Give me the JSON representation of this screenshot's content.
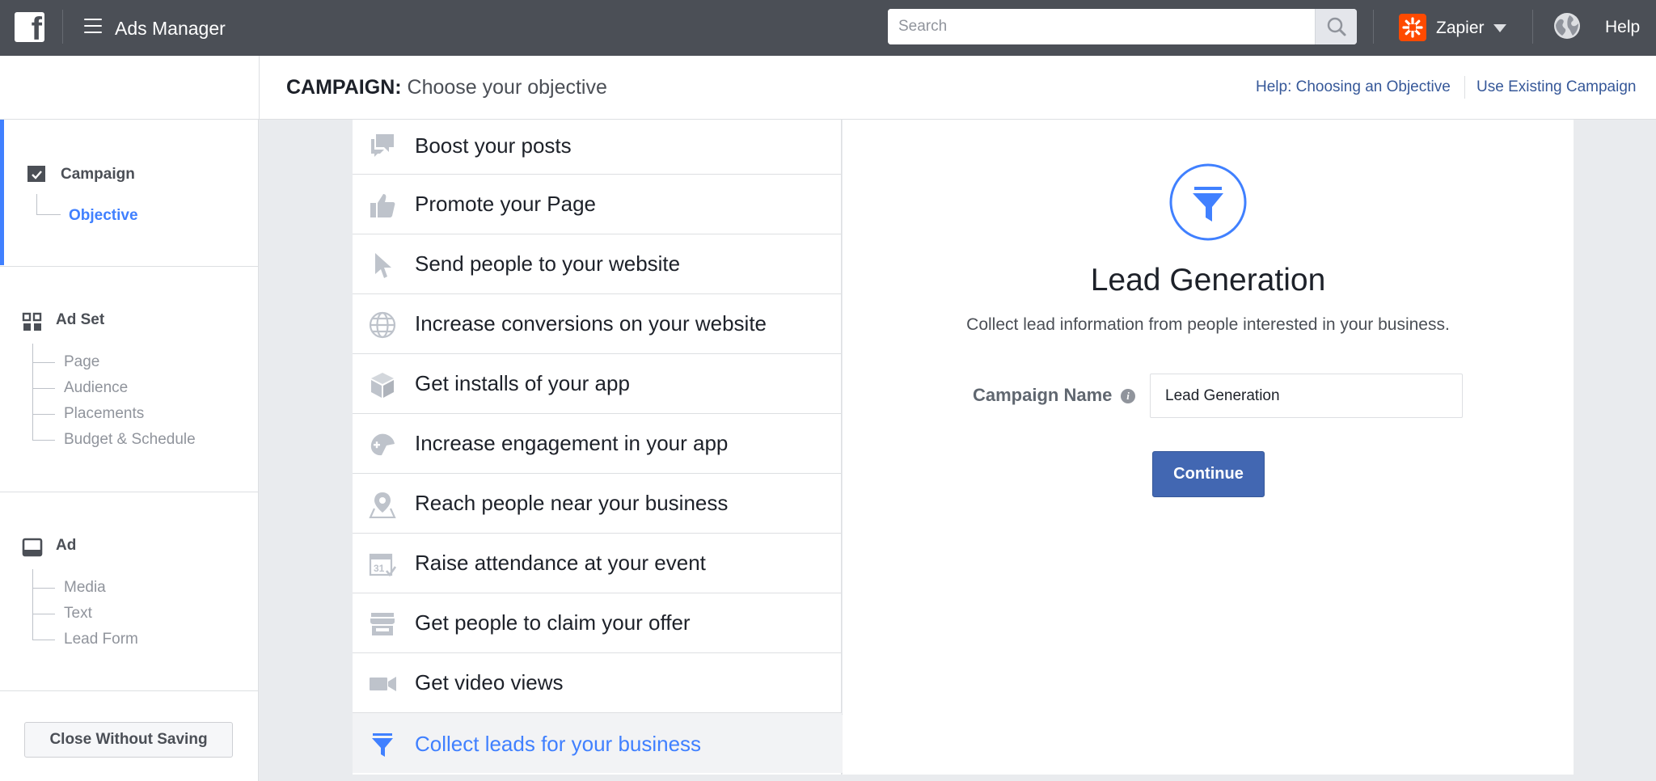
{
  "topbar": {
    "logo_letter": "f",
    "app_title": "Ads Manager",
    "search_placeholder": "Search",
    "account_name": "Zapier",
    "help_label": "Help"
  },
  "header": {
    "title_prefix": "CAMPAIGN:",
    "title_text": "Choose your objective",
    "links": [
      "Help: Choosing an Objective",
      "Use Existing Campaign"
    ]
  },
  "sidebar": {
    "campaign": {
      "title": "Campaign",
      "items": [
        "Objective"
      ],
      "active_item": "Objective"
    },
    "ad_set": {
      "title": "Ad Set",
      "items": [
        "Page",
        "Audience",
        "Placements",
        "Budget & Schedule"
      ]
    },
    "ad": {
      "title": "Ad",
      "items": [
        "Media",
        "Text",
        "Lead Form"
      ]
    },
    "close_button": "Close Without Saving"
  },
  "objectives": [
    {
      "label": "Boost your posts",
      "icon": "speech-bubbles-icon"
    },
    {
      "label": "Promote your Page",
      "icon": "thumbs-up-icon"
    },
    {
      "label": "Send people to your website",
      "icon": "cursor-icon"
    },
    {
      "label": "Increase conversions on your website",
      "icon": "globe-icon"
    },
    {
      "label": "Get installs of your app",
      "icon": "box-icon"
    },
    {
      "label": "Increase engagement in your app",
      "icon": "gamepad-icon"
    },
    {
      "label": "Reach people near your business",
      "icon": "map-pin-icon"
    },
    {
      "label": "Raise attendance at your event",
      "icon": "calendar-icon"
    },
    {
      "label": "Get people to claim your offer",
      "icon": "storefront-icon"
    },
    {
      "label": "Get video views",
      "icon": "video-camera-icon"
    },
    {
      "label": "Collect leads for your business",
      "icon": "funnel-icon",
      "selected": true
    }
  ],
  "detail": {
    "title": "Lead Generation",
    "description": "Collect lead information from people interested in your business.",
    "field_label": "Campaign Name",
    "field_value": "Lead Generation",
    "continue_label": "Continue"
  },
  "colors": {
    "topbar": "#4b4f56",
    "accent": "#4080ff",
    "button": "#4267b2",
    "link": "#365899",
    "zapier": "#ff4a00"
  }
}
